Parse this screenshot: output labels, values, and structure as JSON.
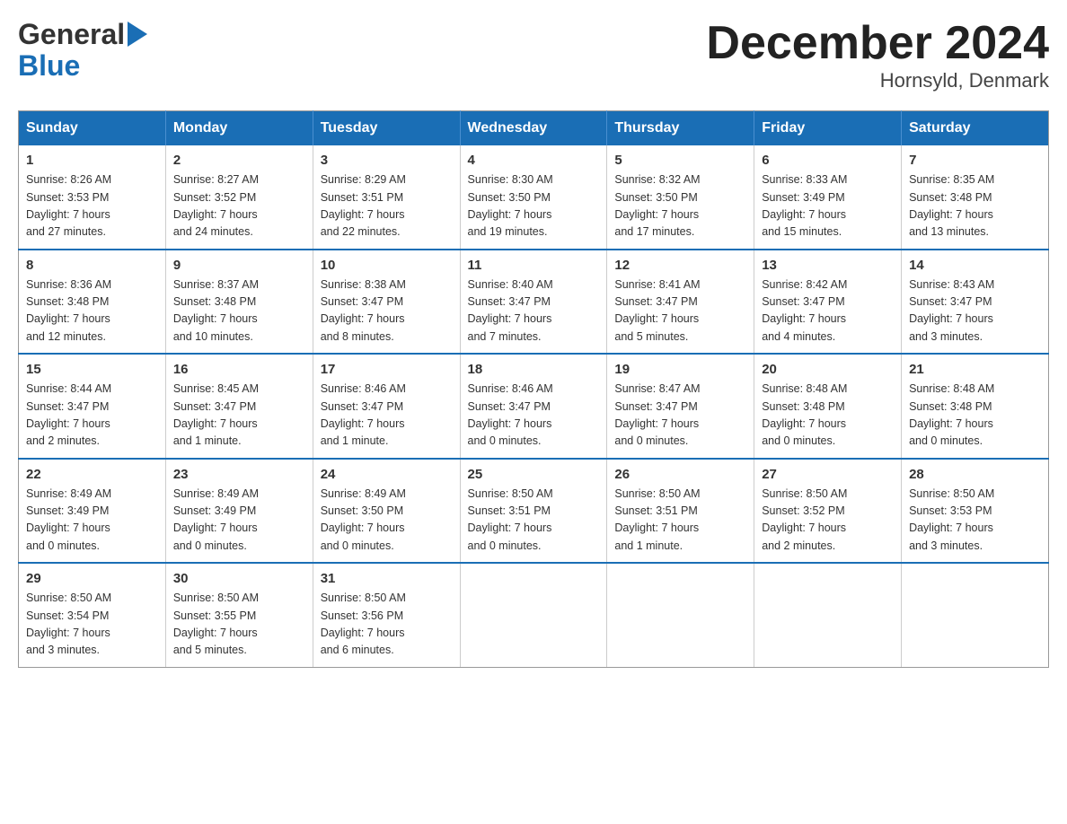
{
  "logo": {
    "general": "General",
    "blue": "Blue"
  },
  "title": "December 2024",
  "subtitle": "Hornsyld, Denmark",
  "weekdays": [
    "Sunday",
    "Monday",
    "Tuesday",
    "Wednesday",
    "Thursday",
    "Friday",
    "Saturday"
  ],
  "weeks": [
    [
      {
        "day": "1",
        "sunrise": "Sunrise: 8:26 AM",
        "sunset": "Sunset: 3:53 PM",
        "daylight": "Daylight: 7 hours",
        "daylight2": "and 27 minutes."
      },
      {
        "day": "2",
        "sunrise": "Sunrise: 8:27 AM",
        "sunset": "Sunset: 3:52 PM",
        "daylight": "Daylight: 7 hours",
        "daylight2": "and 24 minutes."
      },
      {
        "day": "3",
        "sunrise": "Sunrise: 8:29 AM",
        "sunset": "Sunset: 3:51 PM",
        "daylight": "Daylight: 7 hours",
        "daylight2": "and 22 minutes."
      },
      {
        "day": "4",
        "sunrise": "Sunrise: 8:30 AM",
        "sunset": "Sunset: 3:50 PM",
        "daylight": "Daylight: 7 hours",
        "daylight2": "and 19 minutes."
      },
      {
        "day": "5",
        "sunrise": "Sunrise: 8:32 AM",
        "sunset": "Sunset: 3:50 PM",
        "daylight": "Daylight: 7 hours",
        "daylight2": "and 17 minutes."
      },
      {
        "day": "6",
        "sunrise": "Sunrise: 8:33 AM",
        "sunset": "Sunset: 3:49 PM",
        "daylight": "Daylight: 7 hours",
        "daylight2": "and 15 minutes."
      },
      {
        "day": "7",
        "sunrise": "Sunrise: 8:35 AM",
        "sunset": "Sunset: 3:48 PM",
        "daylight": "Daylight: 7 hours",
        "daylight2": "and 13 minutes."
      }
    ],
    [
      {
        "day": "8",
        "sunrise": "Sunrise: 8:36 AM",
        "sunset": "Sunset: 3:48 PM",
        "daylight": "Daylight: 7 hours",
        "daylight2": "and 12 minutes."
      },
      {
        "day": "9",
        "sunrise": "Sunrise: 8:37 AM",
        "sunset": "Sunset: 3:48 PM",
        "daylight": "Daylight: 7 hours",
        "daylight2": "and 10 minutes."
      },
      {
        "day": "10",
        "sunrise": "Sunrise: 8:38 AM",
        "sunset": "Sunset: 3:47 PM",
        "daylight": "Daylight: 7 hours",
        "daylight2": "and 8 minutes."
      },
      {
        "day": "11",
        "sunrise": "Sunrise: 8:40 AM",
        "sunset": "Sunset: 3:47 PM",
        "daylight": "Daylight: 7 hours",
        "daylight2": "and 7 minutes."
      },
      {
        "day": "12",
        "sunrise": "Sunrise: 8:41 AM",
        "sunset": "Sunset: 3:47 PM",
        "daylight": "Daylight: 7 hours",
        "daylight2": "and 5 minutes."
      },
      {
        "day": "13",
        "sunrise": "Sunrise: 8:42 AM",
        "sunset": "Sunset: 3:47 PM",
        "daylight": "Daylight: 7 hours",
        "daylight2": "and 4 minutes."
      },
      {
        "day": "14",
        "sunrise": "Sunrise: 8:43 AM",
        "sunset": "Sunset: 3:47 PM",
        "daylight": "Daylight: 7 hours",
        "daylight2": "and 3 minutes."
      }
    ],
    [
      {
        "day": "15",
        "sunrise": "Sunrise: 8:44 AM",
        "sunset": "Sunset: 3:47 PM",
        "daylight": "Daylight: 7 hours",
        "daylight2": "and 2 minutes."
      },
      {
        "day": "16",
        "sunrise": "Sunrise: 8:45 AM",
        "sunset": "Sunset: 3:47 PM",
        "daylight": "Daylight: 7 hours",
        "daylight2": "and 1 minute."
      },
      {
        "day": "17",
        "sunrise": "Sunrise: 8:46 AM",
        "sunset": "Sunset: 3:47 PM",
        "daylight": "Daylight: 7 hours",
        "daylight2": "and 1 minute."
      },
      {
        "day": "18",
        "sunrise": "Sunrise: 8:46 AM",
        "sunset": "Sunset: 3:47 PM",
        "daylight": "Daylight: 7 hours",
        "daylight2": "and 0 minutes."
      },
      {
        "day": "19",
        "sunrise": "Sunrise: 8:47 AM",
        "sunset": "Sunset: 3:47 PM",
        "daylight": "Daylight: 7 hours",
        "daylight2": "and 0 minutes."
      },
      {
        "day": "20",
        "sunrise": "Sunrise: 8:48 AM",
        "sunset": "Sunset: 3:48 PM",
        "daylight": "Daylight: 7 hours",
        "daylight2": "and 0 minutes."
      },
      {
        "day": "21",
        "sunrise": "Sunrise: 8:48 AM",
        "sunset": "Sunset: 3:48 PM",
        "daylight": "Daylight: 7 hours",
        "daylight2": "and 0 minutes."
      }
    ],
    [
      {
        "day": "22",
        "sunrise": "Sunrise: 8:49 AM",
        "sunset": "Sunset: 3:49 PM",
        "daylight": "Daylight: 7 hours",
        "daylight2": "and 0 minutes."
      },
      {
        "day": "23",
        "sunrise": "Sunrise: 8:49 AM",
        "sunset": "Sunset: 3:49 PM",
        "daylight": "Daylight: 7 hours",
        "daylight2": "and 0 minutes."
      },
      {
        "day": "24",
        "sunrise": "Sunrise: 8:49 AM",
        "sunset": "Sunset: 3:50 PM",
        "daylight": "Daylight: 7 hours",
        "daylight2": "and 0 minutes."
      },
      {
        "day": "25",
        "sunrise": "Sunrise: 8:50 AM",
        "sunset": "Sunset: 3:51 PM",
        "daylight": "Daylight: 7 hours",
        "daylight2": "and 0 minutes."
      },
      {
        "day": "26",
        "sunrise": "Sunrise: 8:50 AM",
        "sunset": "Sunset: 3:51 PM",
        "daylight": "Daylight: 7 hours",
        "daylight2": "and 1 minute."
      },
      {
        "day": "27",
        "sunrise": "Sunrise: 8:50 AM",
        "sunset": "Sunset: 3:52 PM",
        "daylight": "Daylight: 7 hours",
        "daylight2": "and 2 minutes."
      },
      {
        "day": "28",
        "sunrise": "Sunrise: 8:50 AM",
        "sunset": "Sunset: 3:53 PM",
        "daylight": "Daylight: 7 hours",
        "daylight2": "and 3 minutes."
      }
    ],
    [
      {
        "day": "29",
        "sunrise": "Sunrise: 8:50 AM",
        "sunset": "Sunset: 3:54 PM",
        "daylight": "Daylight: 7 hours",
        "daylight2": "and 3 minutes."
      },
      {
        "day": "30",
        "sunrise": "Sunrise: 8:50 AM",
        "sunset": "Sunset: 3:55 PM",
        "daylight": "Daylight: 7 hours",
        "daylight2": "and 5 minutes."
      },
      {
        "day": "31",
        "sunrise": "Sunrise: 8:50 AM",
        "sunset": "Sunset: 3:56 PM",
        "daylight": "Daylight: 7 hours",
        "daylight2": "and 6 minutes."
      },
      null,
      null,
      null,
      null
    ]
  ]
}
